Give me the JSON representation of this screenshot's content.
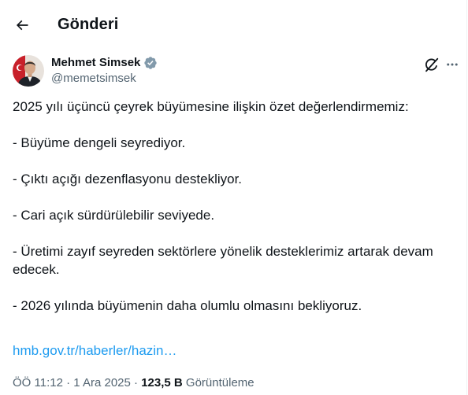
{
  "header": {
    "title": "Gönderi"
  },
  "author": {
    "name": "Mehmet Simsek",
    "handle": "@memetsimsek",
    "verified": true
  },
  "post": {
    "lines": [
      "2025 yılı üçüncü çeyrek büyümesine ilişkin özet değerlendirmemiz:",
      "- Büyüme dengeli seyrediyor.",
      "- Çıktı açığı dezenflasyonu destekliyor.",
      "- Cari açık sürdürülebilir seviyede.",
      "- Üretimi zayıf seyreden sektörlere yönelik desteklerimiz artarak devam edecek.",
      "- 2026 yılında büyümenin daha olumlu olmasını bekliyoruz."
    ],
    "link_text": "hmb.gov.tr/haberler/hazin…"
  },
  "meta": {
    "time": "ÖÖ 11:12",
    "separator": "·",
    "date": "1 Ara 2025",
    "views_count": "123,5 B",
    "views_label": "Görüntüleme"
  },
  "icons": {
    "back": "arrow-left-icon",
    "verified": "verified-badge-icon",
    "grok": "grok-icon",
    "more": "more-horizontal-icon"
  },
  "colors": {
    "text": "#0f1419",
    "secondary": "#536471",
    "link": "#1d9bf0",
    "verified": "#829aab"
  }
}
